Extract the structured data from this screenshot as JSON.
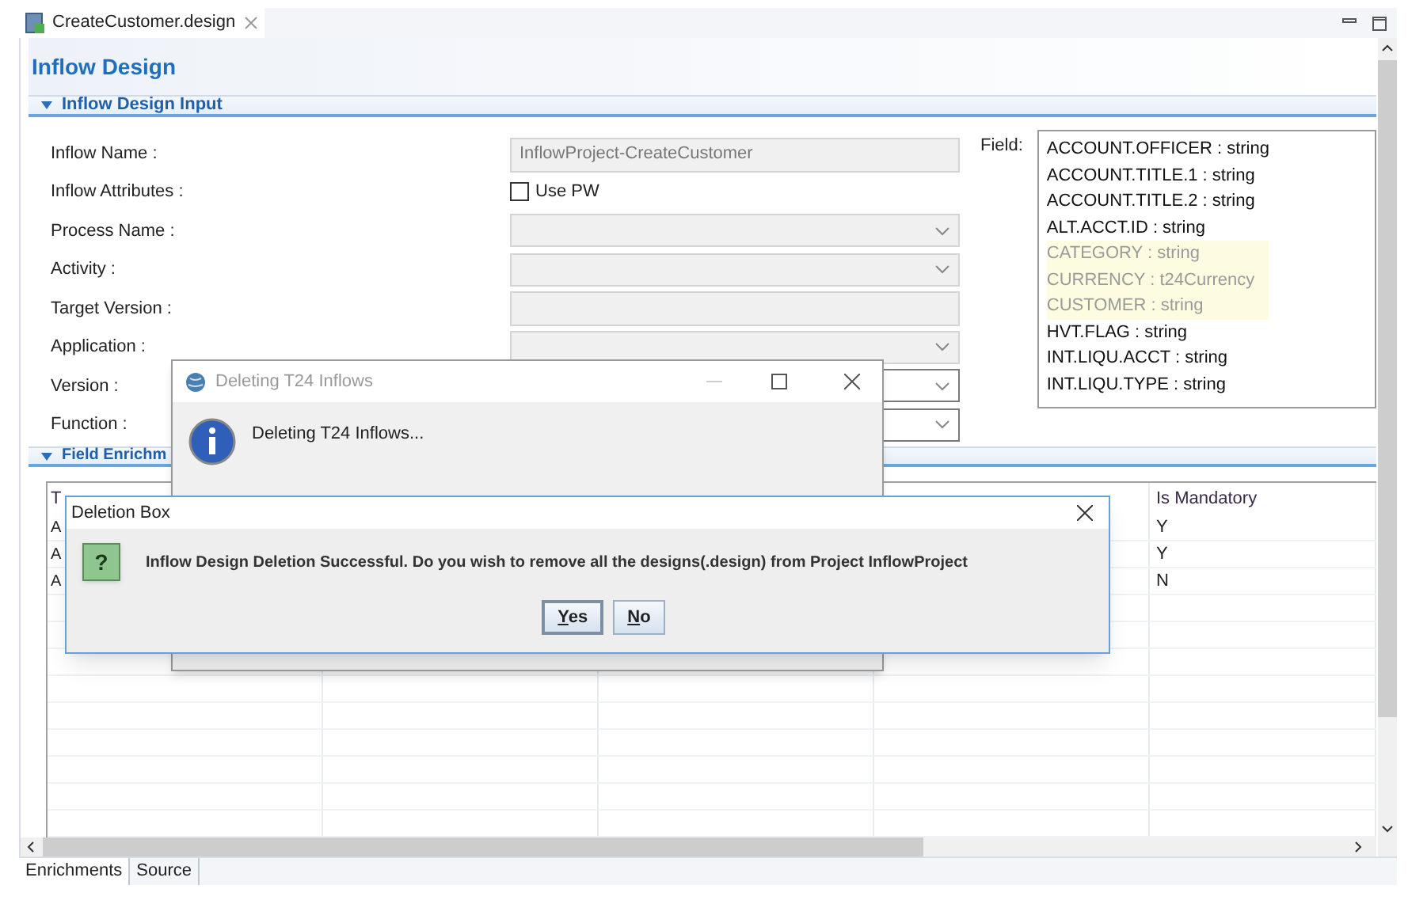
{
  "editor_tab": {
    "title": "CreateCustomer.design",
    "selected": true
  },
  "page_title": "Inflow Design",
  "input_section": {
    "title": "Inflow Design Input",
    "expanded": true,
    "rows": [
      {
        "label": "Inflow Name :",
        "kind": "text",
        "value": "InflowProject-CreateCustomer",
        "disabled": true
      },
      {
        "label": "Inflow Attributes :",
        "kind": "checkbox",
        "option": "Use PW",
        "checked": false
      },
      {
        "label": "Process Name :",
        "kind": "dropdown",
        "disabled": true
      },
      {
        "label": "Activity :",
        "kind": "dropdown",
        "disabled": true
      },
      {
        "label": "Target Version :",
        "kind": "text",
        "disabled": true
      },
      {
        "label": "Application :",
        "kind": "dropdown",
        "disabled": true
      },
      {
        "label": "Version :",
        "kind": "dropdown",
        "disabled": false
      },
      {
        "label": "Function :",
        "kind": "dropdown",
        "disabled": false
      }
    ],
    "field_label": "Field:",
    "fields": [
      {
        "text": "ACCOUNT.OFFICER : string",
        "highlighted": false
      },
      {
        "text": "ACCOUNT.TITLE.1 : string",
        "highlighted": false
      },
      {
        "text": "ACCOUNT.TITLE.2 : string",
        "highlighted": false
      },
      {
        "text": "ALT.ACCT.ID : string",
        "highlighted": false
      },
      {
        "text": "CATEGORY : string",
        "highlighted": true
      },
      {
        "text": "CURRENCY : t24Currency",
        "highlighted": true
      },
      {
        "text": "CUSTOMER : string",
        "highlighted": true
      },
      {
        "text": "HVT.FLAG : string",
        "highlighted": false
      },
      {
        "text": "INT.LIQU.ACCT : string",
        "highlighted": false
      },
      {
        "text": "INT.LIQU.TYPE : string",
        "highlighted": false
      }
    ]
  },
  "enrichment_section": {
    "title": "Field Enrichm",
    "expanded": true,
    "headers": {
      "column_1": "T",
      "column_5": "Is Mandatory"
    },
    "rows": [
      {
        "column_1": "A",
        "column_5": "Y"
      },
      {
        "column_1": "A",
        "column_5": "Y"
      },
      {
        "column_1": "A",
        "column_5": "N"
      }
    ]
  },
  "bottom_tabs": [
    {
      "label": "Enrichments",
      "selected": true
    },
    {
      "label": "Source",
      "selected": false
    }
  ],
  "progress_dialog": {
    "title": "Deleting T24 Inflows",
    "message": "Deleting T24 Inflows..."
  },
  "deletion_dialog": {
    "title": "Deletion Box",
    "icon": "?",
    "message": "Inflow Design Deletion Successful. Do you wish to remove all the designs(.design) from Project InflowProject",
    "buttons": [
      {
        "label": "Yes",
        "focused": true
      },
      {
        "label": "No",
        "focused": false
      }
    ]
  }
}
